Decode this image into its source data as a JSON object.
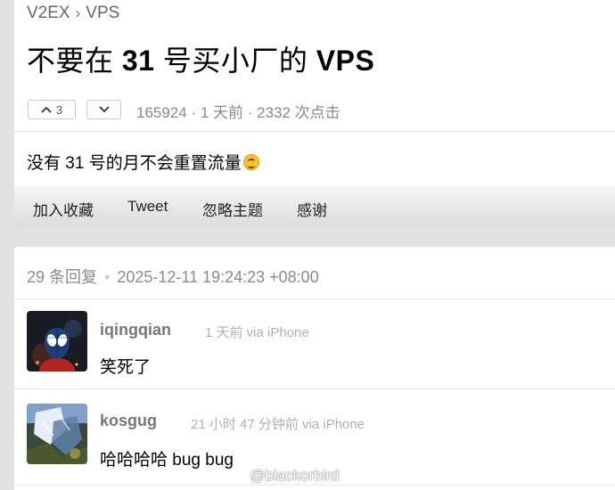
{
  "topic": {
    "breadcrumb": {
      "site": "V2EX",
      "separator": "›",
      "node": "VPS"
    },
    "title_parts": [
      "不要在 ",
      "31",
      " 号买小厂的 ",
      "VPS"
    ],
    "votes": {
      "up_count": "3"
    },
    "meta": "165924 · 1 天前 · 2332 次点击",
    "content": "没有 31 号的月不会重置流量",
    "content_emoji": "upside-down-face-emoji",
    "toolbar": {
      "favorite": "加入收藏",
      "tweet": "Tweet",
      "ignore": "忽略主题",
      "thanks": "感谢"
    }
  },
  "replies_header": {
    "count": "29 条回复",
    "separator": "•",
    "timestamp": "2025-12-11 19:24:23 +08:00"
  },
  "replies": [
    {
      "username": "iqingqian",
      "time": "1 天前 via iPhone",
      "text": "笑死了"
    },
    {
      "username": "kosgug",
      "time": "21 小时 47 分钟前 via iPhone",
      "text": "哈哈哈哈 bug bug"
    }
  ],
  "watermark": "@blackorbird",
  "colors": {
    "page_background": "#e2e2e2",
    "card_background": "#ffffff",
    "meta_gray": "#8a8a8a"
  }
}
